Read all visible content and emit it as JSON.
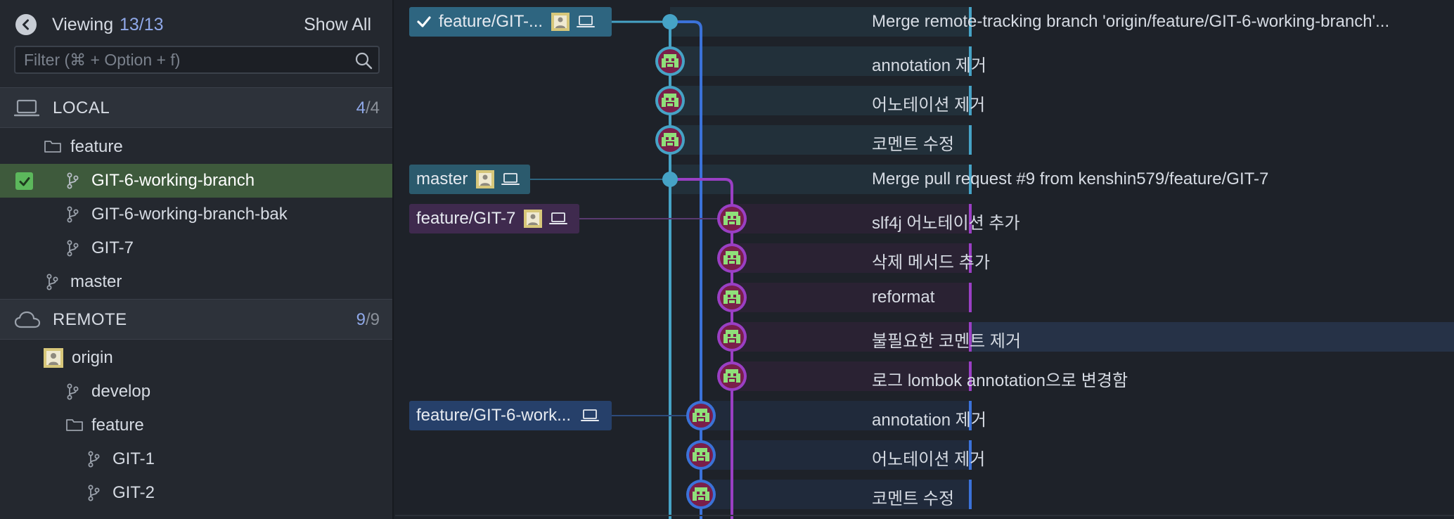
{
  "sidebar": {
    "viewing_label": "Viewing",
    "viewing_count": "13/13",
    "show_all": "Show All",
    "filter_placeholder": "Filter (⌘ + Option + f)",
    "local": {
      "title": "LOCAL",
      "count_shown": "4",
      "count_total": "/4",
      "items": [
        {
          "label": "feature",
          "type": "folder"
        },
        {
          "label": "GIT-6-working-branch",
          "type": "branch",
          "checked_out": true
        },
        {
          "label": "GIT-6-working-branch-bak",
          "type": "branch"
        },
        {
          "label": "GIT-7",
          "type": "branch"
        },
        {
          "label": "master",
          "type": "branch"
        }
      ]
    },
    "remote": {
      "title": "REMOTE",
      "count_shown": "9",
      "count_total": "/9",
      "items": [
        {
          "label": "origin",
          "type": "remote"
        },
        {
          "label": "develop",
          "type": "branch"
        },
        {
          "label": "feature",
          "type": "folder"
        },
        {
          "label": "GIT-1",
          "type": "branch"
        },
        {
          "label": "GIT-2",
          "type": "branch"
        }
      ]
    }
  },
  "graph": {
    "pills": [
      {
        "label": "feature/GIT-...",
        "color": "#2e6580",
        "checked": true
      },
      {
        "label": "master",
        "color": "#2b5a6d"
      },
      {
        "label": "feature/GIT-7",
        "color": "#3f2a4e"
      },
      {
        "label": "feature/GIT-6-work...",
        "color": "#26406a"
      }
    ],
    "commits": [
      {
        "message": "Merge remote-tracking branch 'origin/feature/GIT-6-working-branch'..."
      },
      {
        "message": "annotation 제거"
      },
      {
        "message": "어노테이션 제거"
      },
      {
        "message": "코멘트 수정"
      },
      {
        "message": "Merge pull request #9 from kenshin579/feature/GIT-7"
      },
      {
        "message": "slf4j 어노테이션 추가"
      },
      {
        "message": "삭제 메서드 추가"
      },
      {
        "message": "reformat"
      },
      {
        "message": "불필요한 코멘트 제거"
      },
      {
        "message": "로그 lombok annotation으로 변경함"
      },
      {
        "message": "annotation 제거"
      },
      {
        "message": "어노테이션 제거"
      },
      {
        "message": "코멘트 수정"
      }
    ],
    "colors": {
      "teal": "#46a3c6",
      "blue": "#3b72d9",
      "purple": "#9a3fc4"
    }
  }
}
